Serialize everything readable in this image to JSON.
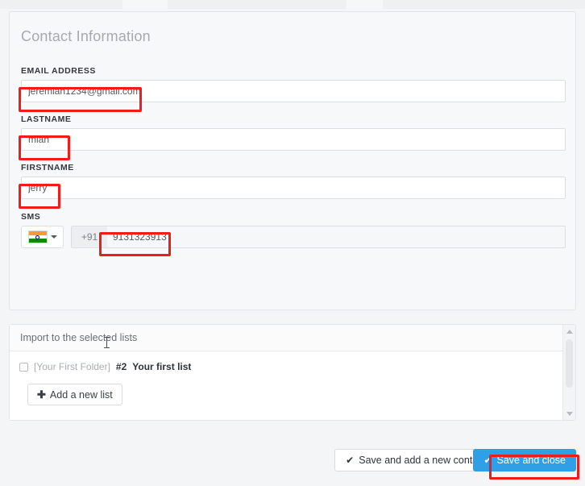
{
  "panel": {
    "heading": "Contact Information"
  },
  "fields": {
    "email": {
      "label": "EMAIL ADDRESS",
      "value": "jeremiah1234@gmail.com",
      "placeholder": ""
    },
    "lastname": {
      "label": "LASTNAME",
      "value": "miah",
      "placeholder": ""
    },
    "firstname": {
      "label": "FIRSTNAME",
      "value": "jerry",
      "placeholder": ""
    },
    "sms": {
      "label": "SMS",
      "country_flag": "india-flag-icon",
      "dial_code": "+91",
      "value": "9131323913",
      "placeholder": ""
    }
  },
  "lists": {
    "header": "Import to the selected lists",
    "items": [
      {
        "folder": "[Your First Folder]",
        "number": "#2",
        "name": "Your first list",
        "checked": false
      }
    ],
    "add_button": {
      "icon": "plus-icon",
      "label": "Add a new list"
    },
    "scrollbar": {
      "up_icon": "chevron-up-icon",
      "down_icon": "chevron-down-icon"
    }
  },
  "footer": {
    "save_add_label": "Save and add a new contact",
    "save_close_label": "Save and close",
    "check_icon": "check-icon"
  },
  "colors": {
    "primary": "#2f9fe8",
    "annotation": "#f01c1c",
    "page_background": "#f4f5f7",
    "heading": "#a5aab0",
    "label": "#33383d"
  }
}
